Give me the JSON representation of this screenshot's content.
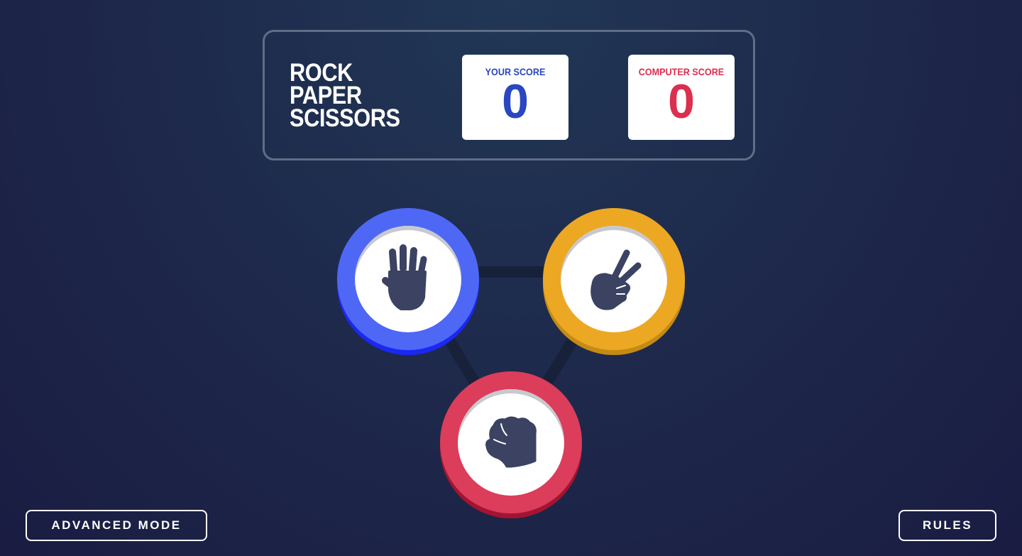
{
  "header": {
    "title_lines": [
      "ROCK",
      "PAPER",
      "SCISSORS"
    ],
    "player_score": {
      "label": "YOUR SCORE",
      "value": "0"
    },
    "computer_score": {
      "label": "COMPUTER SCORE",
      "value": "0"
    }
  },
  "choices": [
    {
      "name": "paper",
      "icon": "paper-hand-icon",
      "ring_color": "#4e67f5"
    },
    {
      "name": "scissors",
      "icon": "scissors-hand-icon",
      "ring_color": "#eca823"
    },
    {
      "name": "rock",
      "icon": "rock-fist-icon",
      "ring_color": "#db3d5a"
    }
  ],
  "buttons": {
    "advanced_mode_label": "ADVANCED MODE",
    "rules_label": "RULES"
  },
  "colors": {
    "player_accent": "#2a46c0",
    "computer_accent": "#dc2e4e",
    "icon_color": "#3b4262"
  }
}
